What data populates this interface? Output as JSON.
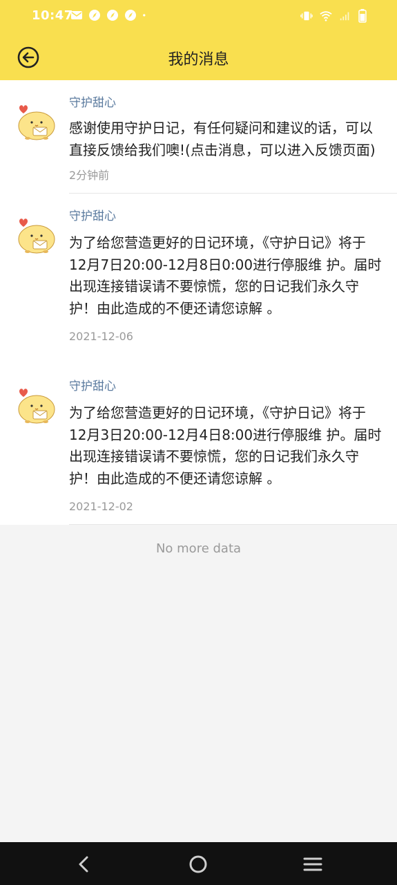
{
  "status_bar": {
    "time": "10:47",
    "left_icons": [
      "mail-icon",
      "compass-icon",
      "compass-icon",
      "compass-icon",
      "dot-icon"
    ],
    "right_icons": [
      "vibrate-icon",
      "wifi-icon",
      "signal-icon",
      "battery-icon"
    ]
  },
  "header": {
    "title": "我的消息",
    "back_icon": "back-circle-arrow-icon",
    "background_color": "#f9df4f"
  },
  "messages": [
    {
      "sender": "守护甜心",
      "content": "感谢使用守护日记，有任何疑问和建议的话，可以直接反馈给我们噢!(点击消息，可以进入反馈页面)",
      "time": "2分钟前",
      "avatar_icon": "chick-avatar-icon"
    },
    {
      "sender": "守护甜心",
      "content": "为了给您营造更好的日记环境，《守护日记》将于12月7日20:00-12月8日0:00进行停服维 护。届时出现连接错误请不要惊慌，您的日记我们永久守护！由此造成的不便还请您谅解 。",
      "time": "2021-12-06",
      "avatar_icon": "chick-avatar-icon"
    },
    {
      "sender": "守护甜心",
      "content": "为了给您营造更好的日记环境，《守护日记》将于12月3日20:00-12月4日8:00进行停服维 护。届时出现连接错误请不要惊慌，您的日记我们永久守护！由此造成的不便还请您谅解 。",
      "time": "2021-12-02",
      "avatar_icon": "chick-avatar-icon"
    }
  ],
  "footer": {
    "no_more": "No more data"
  },
  "nav_bar": {
    "buttons": [
      "back-nav-icon",
      "home-nav-icon",
      "menu-nav-icon"
    ]
  },
  "colors": {
    "accent": "#f9df4f",
    "sender": "#5a7a9e",
    "muted": "#9a9a9a"
  }
}
